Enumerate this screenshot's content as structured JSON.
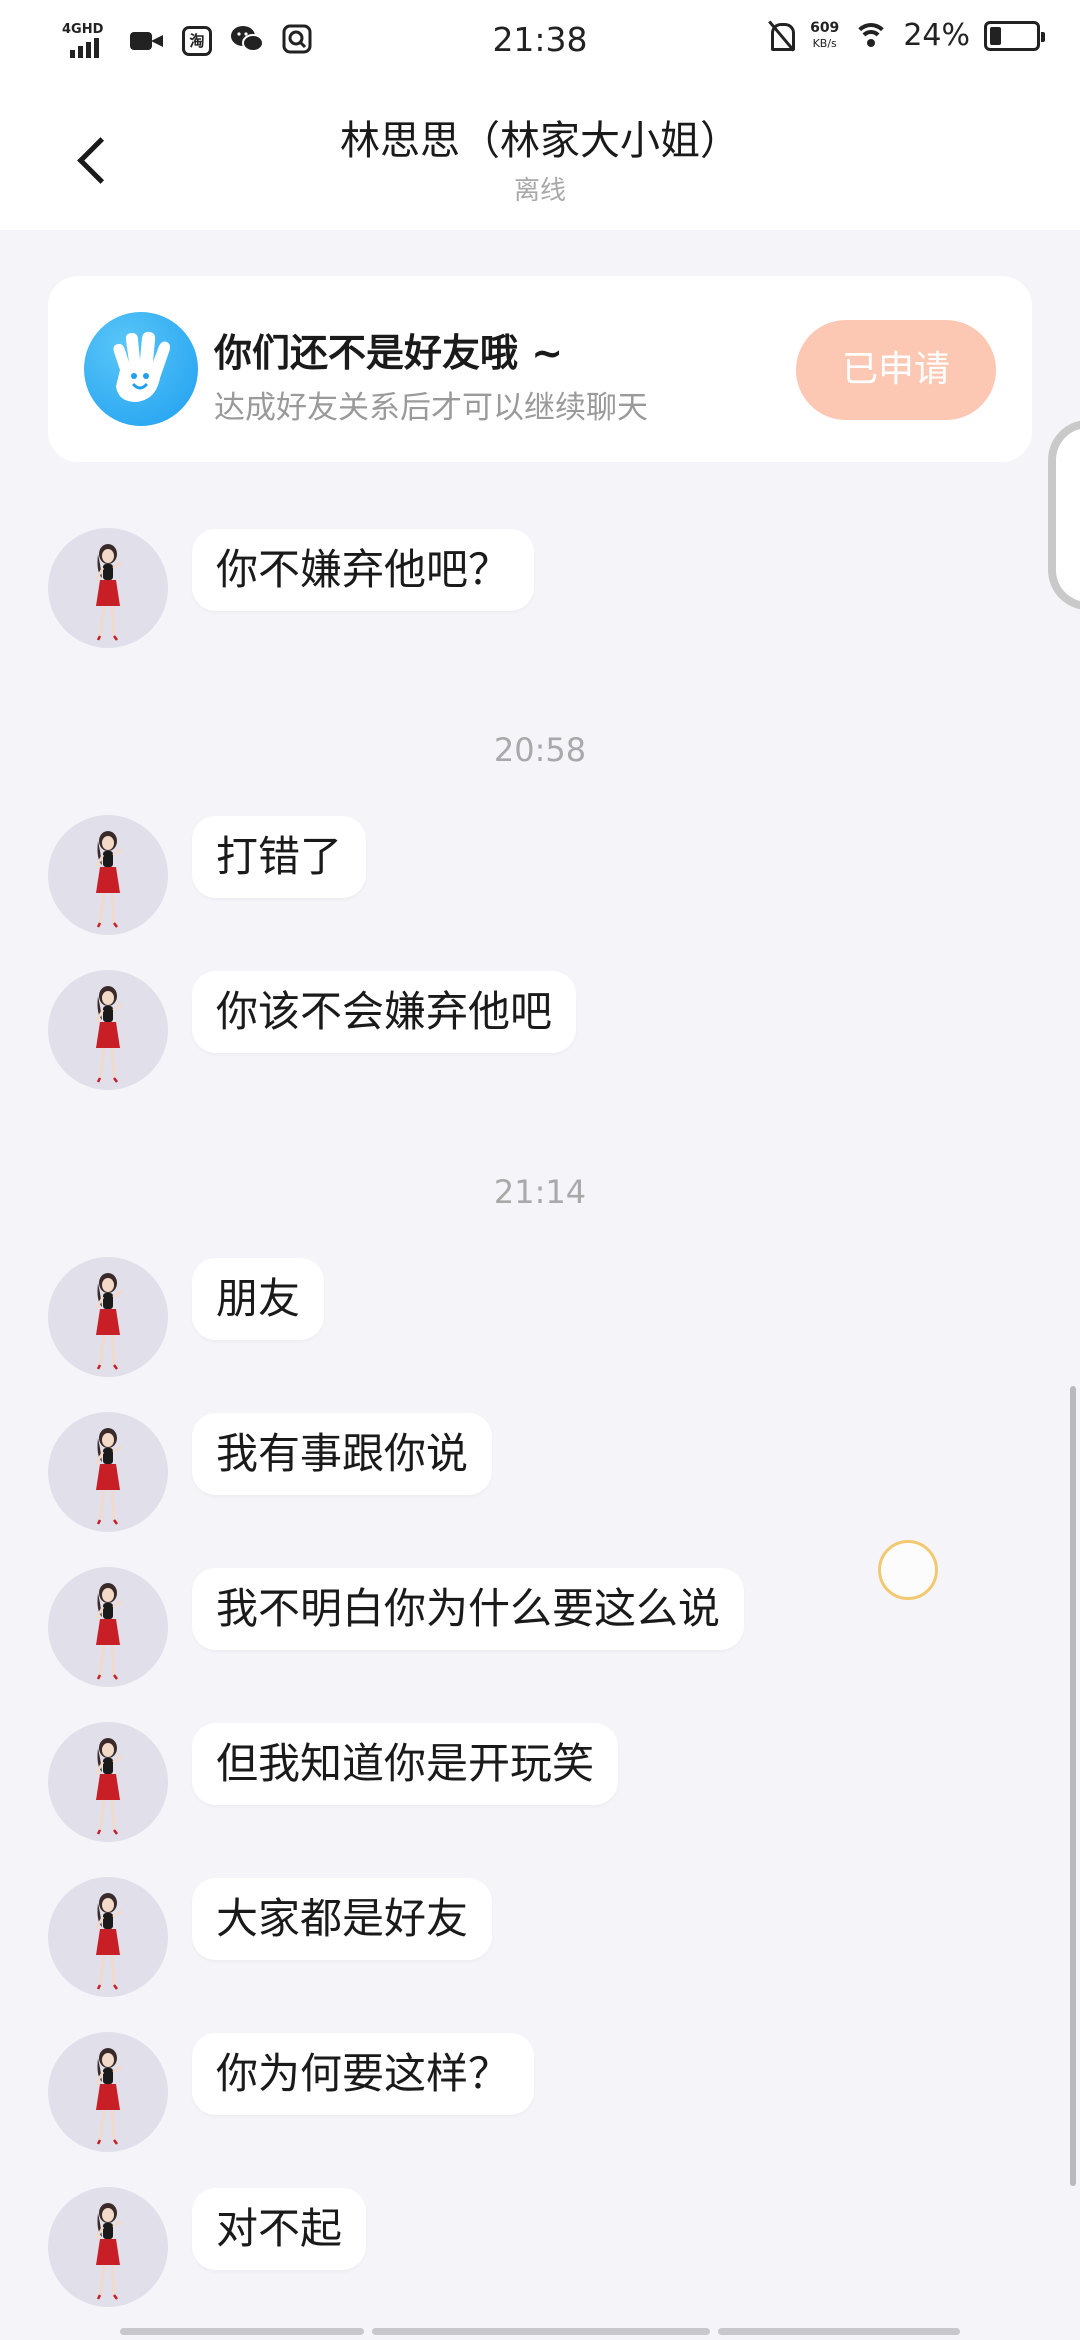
{
  "status_bar": {
    "network": "4GHD",
    "app_icon_1": "淘",
    "time": "21:38",
    "speed_value": "609",
    "speed_unit": "KB/s",
    "battery_percent": "24%",
    "battery_level": 0.24
  },
  "header": {
    "title": "林思思（林家大小姐）",
    "subtitle": "离线"
  },
  "friend_card": {
    "title": "你们还不是好友哦 ~",
    "description": "达成好友关系后才可以继续聊天",
    "button_label": "已申请"
  },
  "messages": [
    {
      "text": "你不嫌弃他吧？"
    },
    {
      "timestamp": "20:58"
    },
    {
      "text": "打错了"
    },
    {
      "text": "你该不会嫌弃他吧"
    },
    {
      "timestamp": "21:14"
    },
    {
      "text": "朋友"
    },
    {
      "text": "我有事跟你说"
    },
    {
      "text": "我不明白你为什么要这么说"
    },
    {
      "text": "但我知道你是开玩笑"
    },
    {
      "text": "大家都是好友"
    },
    {
      "text": "你为何要这样？"
    },
    {
      "text": "对不起"
    }
  ],
  "colors": {
    "accent_button": "#fcc8b3",
    "hand_icon": "#1f9ff0",
    "background": "#f5f4f9"
  }
}
